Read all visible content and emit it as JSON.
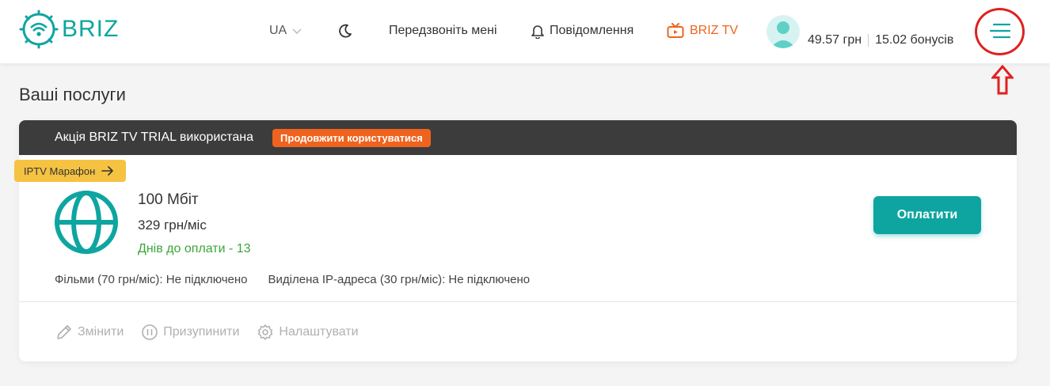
{
  "header": {
    "logo_text": "BRIZ",
    "lang": "UA",
    "callback": "Передзвоніть мені",
    "notifications": "Повідомлення",
    "briz_tv": "BRIZ TV",
    "balance": "49.57 грн",
    "bonuses": "15.02 бонусів",
    "icons": {
      "moon": "moon-icon",
      "bell": "bell-icon",
      "tv": "tv-icon",
      "menu": "menu-icon",
      "avatar": "user-avatar"
    }
  },
  "page": {
    "title": "Ваші послуги"
  },
  "service": {
    "promo_text": "Акція BRIZ TV TRIAL використана",
    "promo_button": "Продовжити користуватися",
    "badge": "IPTV Марафон",
    "speed": "100 Мбіт",
    "price": "329 грн/міс",
    "days_left": "Днів до оплати - 13",
    "pay_button": "Оплатити",
    "addons": [
      "Фільми (70 грн/міс): Не підключено",
      "Виділена IP-адреса (30 грн/міс): Не підключено"
    ],
    "actions": [
      {
        "label": "Змінити",
        "icon": "pencil-icon"
      },
      {
        "label": "Призупинити",
        "icon": "pause-icon"
      },
      {
        "label": "Налаштувати",
        "icon": "gear-icon"
      }
    ]
  },
  "colors": {
    "accent": "#0ea5a0",
    "orange": "#f0631e",
    "green": "#3aa63a",
    "badge": "#f5c242",
    "annotation": "#e02020"
  }
}
